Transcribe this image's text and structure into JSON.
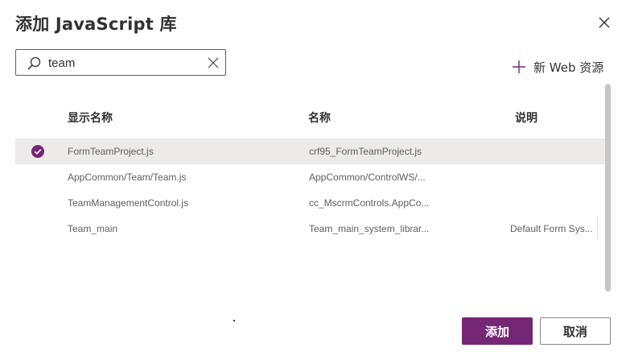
{
  "dialog": {
    "title": "添加 JavaScript 库"
  },
  "search": {
    "value": "team"
  },
  "toolbar": {
    "new_resource_label": "新 Web 资源"
  },
  "table": {
    "columns": [
      "显示名称",
      "名称",
      "说明"
    ],
    "rows": [
      {
        "display_name": "FormTeamProject.js",
        "name": "crf95_FormTeamProject.js",
        "description": "",
        "selected": true
      },
      {
        "display_name": "AppCommon/Team/Team.js",
        "name": "AppCommon/ControlWS/...",
        "description": "",
        "selected": false
      },
      {
        "display_name": "TeamManagementControl.js",
        "name": "cc_MscrmControls.AppCo...",
        "description": "",
        "selected": false
      },
      {
        "display_name": "Team_main",
        "name": "Team_main_system_librar...",
        "description": "Default Form Sys...",
        "selected": false
      }
    ]
  },
  "footer": {
    "add_label": "添加",
    "cancel_label": "取消"
  },
  "colors": {
    "accent": "#742774",
    "selected_row": "#edebe9"
  }
}
